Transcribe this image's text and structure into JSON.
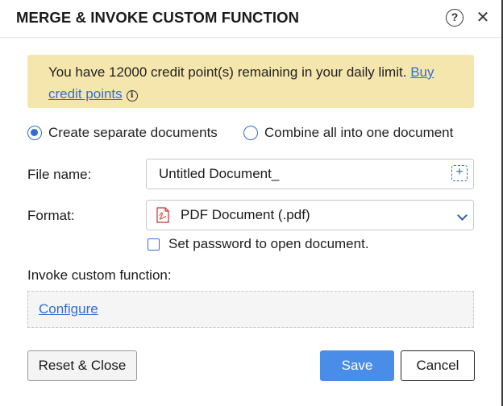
{
  "dialog": {
    "title": "MERGE & INVOKE CUSTOM FUNCTION",
    "help_icon": "?",
    "close_icon": "✕"
  },
  "banner": {
    "text": "You have 12000 credit point(s) remaining in your daily limit.",
    "link": "Buy credit points",
    "info_icon": "i"
  },
  "output_options": [
    {
      "label": "Create separate documents",
      "selected": true
    },
    {
      "label": "Combine all into one document",
      "selected": false
    }
  ],
  "file_name": {
    "label": "File name:",
    "value": "Untitled Document_"
  },
  "format": {
    "label": "Format:",
    "value": "PDF Document (.pdf)",
    "icon": "pdf-file-icon"
  },
  "password": {
    "label": "Set password to open document.",
    "checked": false
  },
  "custom_function": {
    "label": "Invoke custom function:",
    "configure_link": "Configure"
  },
  "buttons": {
    "reset_close": "Reset & Close",
    "save": "Save",
    "cancel": "Cancel"
  },
  "colors": {
    "accent": "#2e6fd6",
    "primary_button": "#4a8de8",
    "banner_bg": "#f5e6ae"
  }
}
